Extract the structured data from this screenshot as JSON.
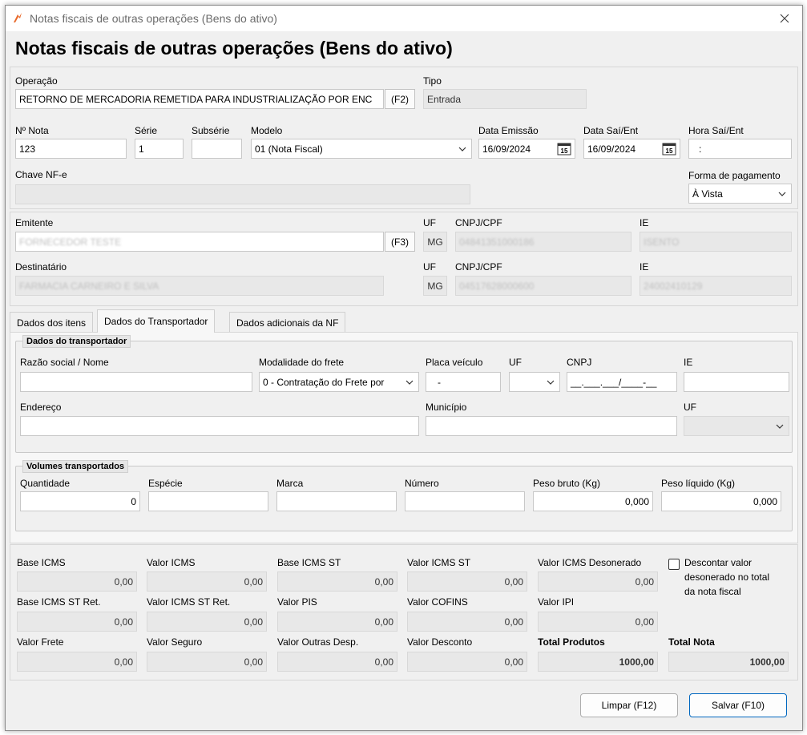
{
  "window": {
    "title": "Notas fiscais de outras operações (Bens do ativo)"
  },
  "form": {
    "heading": "Notas fiscais de outras operações (Bens do ativo)"
  },
  "operacao": {
    "label": "Operação",
    "value": "RETORNO DE MERCADORIA REMETIDA PARA INDUSTRIALIZAÇÃO POR ENC",
    "lookup_button": "(F2)",
    "tipo_label": "Tipo",
    "tipo_value": "Entrada"
  },
  "nota": {
    "numero_label": "Nº Nota",
    "numero_value": "123",
    "serie_label": "Série",
    "serie_value": "1",
    "subserie_label": "Subsérie",
    "subserie_value": "",
    "modelo_label": "Modelo",
    "modelo_value": "01 (Nota Fiscal)",
    "data_emissao_label": "Data Emissão",
    "data_emissao_value": "16/09/2024",
    "data_saient_label": "Data Saí/Ent",
    "data_saient_value": "16/09/2024",
    "hora_label": "Hora Saí/Ent",
    "hora_value": ":",
    "chave_label": "Chave NF-e",
    "chave_value": "",
    "forma_pagto_label": "Forma de pagamento",
    "forma_pagto_value": "À Vista"
  },
  "emitente": {
    "label": "Emitente",
    "value": "FORNECEDOR TESTE",
    "lookup_button": "(F3)",
    "uf_label": "UF",
    "uf_value": "MG",
    "cnpj_label": "CNPJ/CPF",
    "cnpj_value": "04841351000186",
    "ie_label": "IE",
    "ie_value": "ISENTO"
  },
  "destinatario": {
    "label": "Destinatário",
    "value": "FARMACIA CARNEIRO E SILVA",
    "uf_label": "UF",
    "uf_value": "MG",
    "cnpj_label": "CNPJ/CPF",
    "cnpj_value": "04517628000600",
    "ie_label": "IE",
    "ie_value": "24002410129"
  },
  "tabs": [
    {
      "label": "Dados dos itens"
    },
    {
      "label": "Dados do Transportador"
    },
    {
      "label": "Dados adicionais da NF"
    }
  ],
  "transportador": {
    "group_title": "Dados do transportador",
    "razao_label": "Razão social / Nome",
    "razao_value": "",
    "modalidade_label": "Modalidade do frete",
    "modalidade_value": "0 - Contratação do Frete por",
    "placa_label": "Placa veículo",
    "placa_value": "-",
    "uf_label": "UF",
    "uf_value": "",
    "cnpj_label": "CNPJ",
    "cnpj_value": "__.___.___/____-__",
    "ie_label": "IE",
    "ie_value": "",
    "endereco_label": "Endereço",
    "endereco_value": "",
    "municipio_label": "Município",
    "municipio_value": "",
    "uf2_label": "UF",
    "uf2_value": ""
  },
  "volumes": {
    "group_title": "Volumes transportados",
    "quantidade_label": "Quantidade",
    "quantidade_value": "0",
    "especie_label": "Espécie",
    "especie_value": "",
    "marca_label": "Marca",
    "marca_value": "",
    "numero_label": "Número",
    "numero_value": "",
    "peso_bruto_label": "Peso bruto (Kg)",
    "peso_bruto_value": "0,000",
    "peso_liquido_label": "Peso líquido (Kg)",
    "peso_liquido_value": "0,000"
  },
  "totais": {
    "base_icms_label": "Base ICMS",
    "base_icms_value": "0,00",
    "valor_icms_label": "Valor ICMS",
    "valor_icms_value": "0,00",
    "base_icms_st_label": "Base ICMS ST",
    "base_icms_st_value": "0,00",
    "valor_icms_st_label": "Valor ICMS ST",
    "valor_icms_st_value": "0,00",
    "valor_icms_desonerado_label": "Valor ICMS Desonerado",
    "valor_icms_desonerado_value": "0,00",
    "descontar_line1": "Descontar valor",
    "descontar_line2": "desonerado no total",
    "descontar_line3": "da nota fiscal",
    "base_icms_st_ret_label": "Base ICMS ST Ret.",
    "base_icms_st_ret_value": "0,00",
    "valor_icms_st_ret_label": "Valor ICMS ST Ret.",
    "valor_icms_st_ret_value": "0,00",
    "valor_pis_label": "Valor PIS",
    "valor_pis_value": "0,00",
    "valor_cofins_label": "Valor COFINS",
    "valor_cofins_value": "0,00",
    "valor_ipi_label": "Valor IPI",
    "valor_ipi_value": "0,00",
    "valor_frete_label": "Valor Frete",
    "valor_frete_value": "0,00",
    "valor_seguro_label": "Valor Seguro",
    "valor_seguro_value": "0,00",
    "valor_outras_label": "Valor Outras Desp.",
    "valor_outras_value": "0,00",
    "valor_desconto_label": "Valor Desconto",
    "valor_desconto_value": "0,00",
    "total_produtos_label": "Total Produtos",
    "total_produtos_value": "1000,00",
    "total_nota_label": "Total Nota",
    "total_nota_value": "1000,00"
  },
  "buttons": {
    "limpar": "Limpar (F12)",
    "salvar": "Salvar (F10)"
  },
  "colors": {
    "accent": "#0067c0",
    "app_icon": "#e8692a"
  }
}
